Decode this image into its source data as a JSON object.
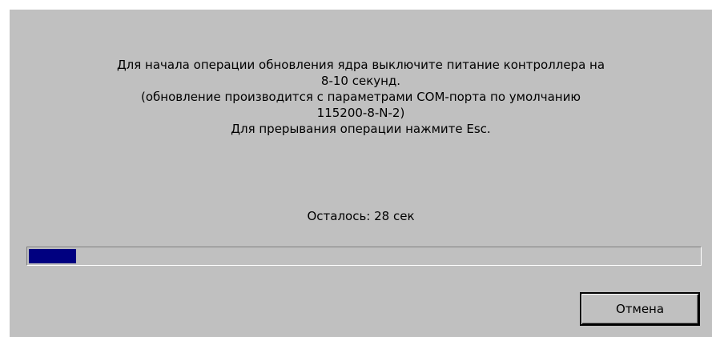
{
  "message": {
    "lines": [
      "Для начала операции обновления ядра выключите питание контроллера на",
      "8-10 секунд.",
      "(обновление производится с параметрами COM-порта по умолчанию",
      "115200-8-N-2)",
      "Для прерывания операции нажмите Esc."
    ]
  },
  "status": {
    "remaining": "Осталось: 28 сек"
  },
  "progress": {
    "fraction": 0.07,
    "color": "#000080"
  },
  "buttons": {
    "cancel_label": "Отмена"
  },
  "colors": {
    "dialog_background": "#c0c0c0"
  }
}
